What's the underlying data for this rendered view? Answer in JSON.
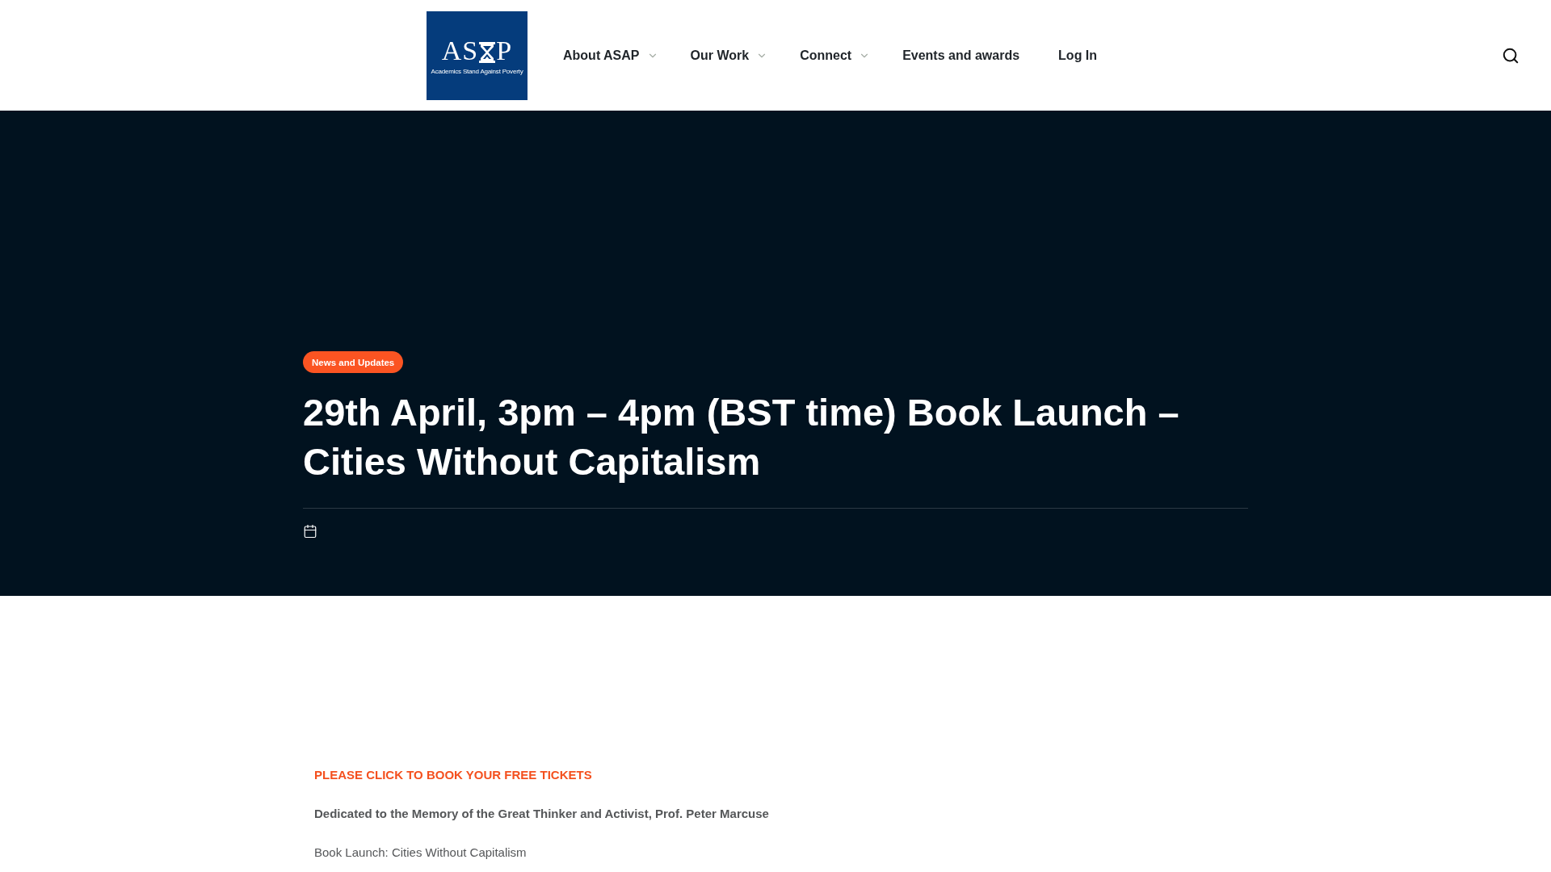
{
  "header": {
    "logo": {
      "letters_left": "AS",
      "letters_right": "P",
      "tagline": "Academics Stand Against Poverty"
    },
    "nav": [
      {
        "label": "About ASAP",
        "has_submenu": true
      },
      {
        "label": "Our Work",
        "has_submenu": true
      },
      {
        "label": "Connect",
        "has_submenu": true
      },
      {
        "label": "Events and awards",
        "has_submenu": false
      },
      {
        "label": "Log In",
        "has_submenu": false
      }
    ]
  },
  "post": {
    "category": "News and Updates",
    "title": "29th April, 3pm – 4pm (BST time) Book Launch – Cities Without Capitalism"
  },
  "content": {
    "link": "PLEASE CLICK TO BOOK YOUR FREE TICKETS",
    "paragraphs": [
      {
        "kind": "bold",
        "text": "Dedicated to the Memory of the Great Thinker and Activist, Prof. Peter Marcuse"
      },
      {
        "kind": "plain",
        "text": "Book Launch: Cities Without Capitalism"
      }
    ]
  }
}
